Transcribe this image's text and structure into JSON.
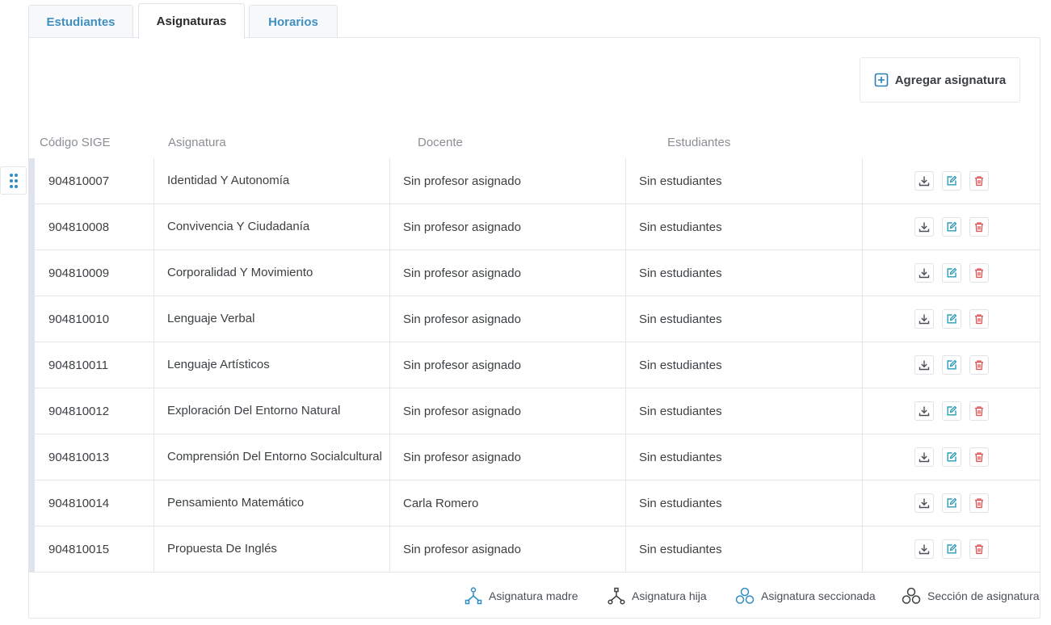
{
  "tabs": [
    {
      "label": "Estudiantes",
      "active": false
    },
    {
      "label": "Asignaturas",
      "active": true
    },
    {
      "label": "Horarios",
      "active": false
    }
  ],
  "toolbar": {
    "add_label": "Agregar asignatura",
    "add_icon": "plus-square-icon"
  },
  "table": {
    "columns": [
      "Código SIGE",
      "Asignatura",
      "Docente",
      "Estudiantes"
    ],
    "rows": [
      {
        "code": "904810007",
        "subject": "Identidad Y Autonomía",
        "teacher": "Sin profesor asignado",
        "students": "Sin estudiantes"
      },
      {
        "code": "904810008",
        "subject": "Convivencia Y Ciudadanía",
        "teacher": "Sin profesor asignado",
        "students": "Sin estudiantes"
      },
      {
        "code": "904810009",
        "subject": "Corporalidad Y Movimiento",
        "teacher": "Sin profesor asignado",
        "students": "Sin estudiantes"
      },
      {
        "code": "904810010",
        "subject": "Lenguaje Verbal",
        "teacher": "Sin profesor asignado",
        "students": "Sin estudiantes"
      },
      {
        "code": "904810011",
        "subject": "Lenguaje Artísticos",
        "teacher": "Sin profesor asignado",
        "students": "Sin estudiantes"
      },
      {
        "code": "904810012",
        "subject": "Exploración Del Entorno Natural",
        "teacher": "Sin profesor asignado",
        "students": "Sin estudiantes"
      },
      {
        "code": "904810013",
        "subject": "Comprensión Del Entorno Socialcultural",
        "teacher": "Sin profesor asignado",
        "students": "Sin estudiantes"
      },
      {
        "code": "904810014",
        "subject": "Pensamiento Matemático",
        "teacher": "Carla Romero",
        "students": "Sin estudiantes"
      },
      {
        "code": "904810015",
        "subject": "Propuesta De Inglés",
        "teacher": "Sin profesor asignado",
        "students": "Sin estudiantes"
      }
    ],
    "row_actions": [
      "download-icon",
      "edit-icon",
      "delete-icon"
    ]
  },
  "legend": [
    {
      "label": "Asignatura madre",
      "icon": "parent-subject-icon"
    },
    {
      "label": "Asignatura hija",
      "icon": "child-subject-icon"
    },
    {
      "label": "Asignatura seccionada",
      "icon": "sectioned-subject-icon"
    },
    {
      "label": "Sección de asignatura",
      "icon": "subject-section-icon"
    }
  ],
  "colors": {
    "tab_link": "#3f8fbf",
    "edit": "#2a9bb7",
    "delete": "#e05252",
    "legend_blue": "#2f8fc4",
    "legend_dark": "#3c4043"
  }
}
